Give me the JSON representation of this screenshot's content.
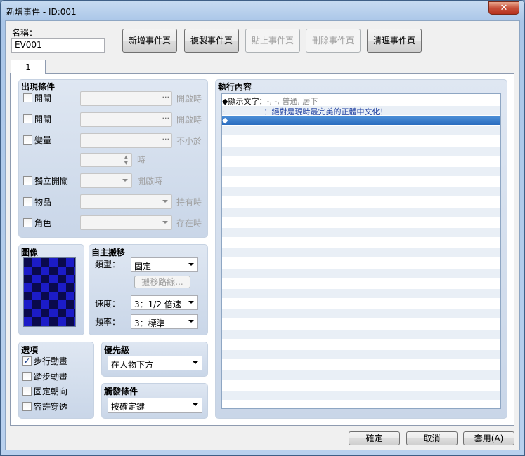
{
  "window": {
    "title": "新增事件 - ID:001",
    "close_glyph": "✕"
  },
  "name_field": {
    "label": "名稱：",
    "value": "EV001"
  },
  "page_buttons": {
    "new": "新增事件頁",
    "copy": "複製事件頁",
    "paste": "貼上事件頁",
    "delete": "刪除事件頁",
    "clear": "清理事件頁"
  },
  "tab": {
    "label": "1"
  },
  "conditions": {
    "title": "出現條件",
    "switch1": {
      "label": "開關",
      "suffix": "開啟時"
    },
    "switch2": {
      "label": "開關",
      "suffix": "開啟時"
    },
    "variable": {
      "label": "變量",
      "suffix": "不小於",
      "value_suffix": "時"
    },
    "self_switch": {
      "label": "獨立開關",
      "suffix": "開啟時"
    },
    "item": {
      "label": "物品",
      "suffix": "持有時"
    },
    "actor": {
      "label": "角色",
      "suffix": "存在時"
    }
  },
  "image": {
    "title": "圖像"
  },
  "movement": {
    "title": "自主搬移",
    "type_label": "類型：",
    "type_value": "固定",
    "route_button": "搬移路線...",
    "speed_label": "速度：",
    "speed_value": "3：1/2 倍速",
    "freq_label": "頻率：",
    "freq_value": "3：標準"
  },
  "options": {
    "title": "選項",
    "items": [
      {
        "label": "步行動畫",
        "checked": true
      },
      {
        "label": "踏步動畫",
        "checked": false
      },
      {
        "label": "固定朝向",
        "checked": false
      },
      {
        "label": "容許穿透",
        "checked": false
      }
    ]
  },
  "priority": {
    "title": "優先級",
    "value": "在人物下方"
  },
  "trigger": {
    "title": "觸發條件",
    "value": "按確定鍵"
  },
  "contents": {
    "title": "執行內容",
    "lines": [
      {
        "prefix": "◆",
        "label": "顯示文字：",
        "detail": "-, -, 普通, 居下"
      },
      {
        "prefix": "·",
        "label": "",
        "detail": "：絕對是現時最完美的正體中文化！"
      },
      {
        "prefix": "◆",
        "label": "",
        "detail": ""
      }
    ]
  },
  "footer": {
    "ok": "確定",
    "cancel": "取消",
    "apply": "套用(A)"
  },
  "colors": {
    "accent": "#2a6cbf",
    "event_text": "#1f3fa0",
    "checker_a": "#0a0a4c",
    "checker_b": "#1c1cc8"
  }
}
